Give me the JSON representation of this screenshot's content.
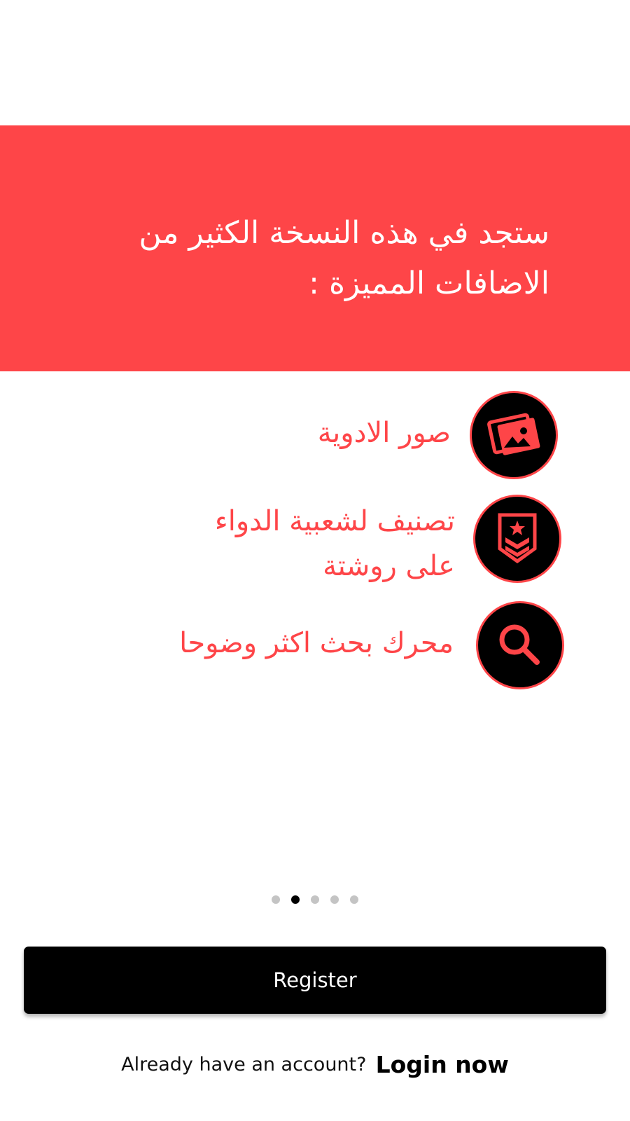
{
  "banner": {
    "text": "ستجد في هذه النسخة الكثير من الاضافات المميزة :"
  },
  "features": [
    {
      "text": "صور الادوية",
      "icon": "pictures-icon"
    },
    {
      "text": "تصنيف لشعبية الدواء على روشتة",
      "icon": "rank-badge-icon"
    },
    {
      "text": "محرك بحث اكثر وضوحا",
      "icon": "search-icon"
    }
  ],
  "pager": {
    "count": 5,
    "active_index": 1
  },
  "register": {
    "label": "Register"
  },
  "login": {
    "prompt": "Already have an account?",
    "link": "Login now"
  },
  "colors": {
    "accent": "#fe4548",
    "primary_button": "#000000",
    "dot_inactive": "#c4c4c4",
    "dot_active": "#000000"
  }
}
